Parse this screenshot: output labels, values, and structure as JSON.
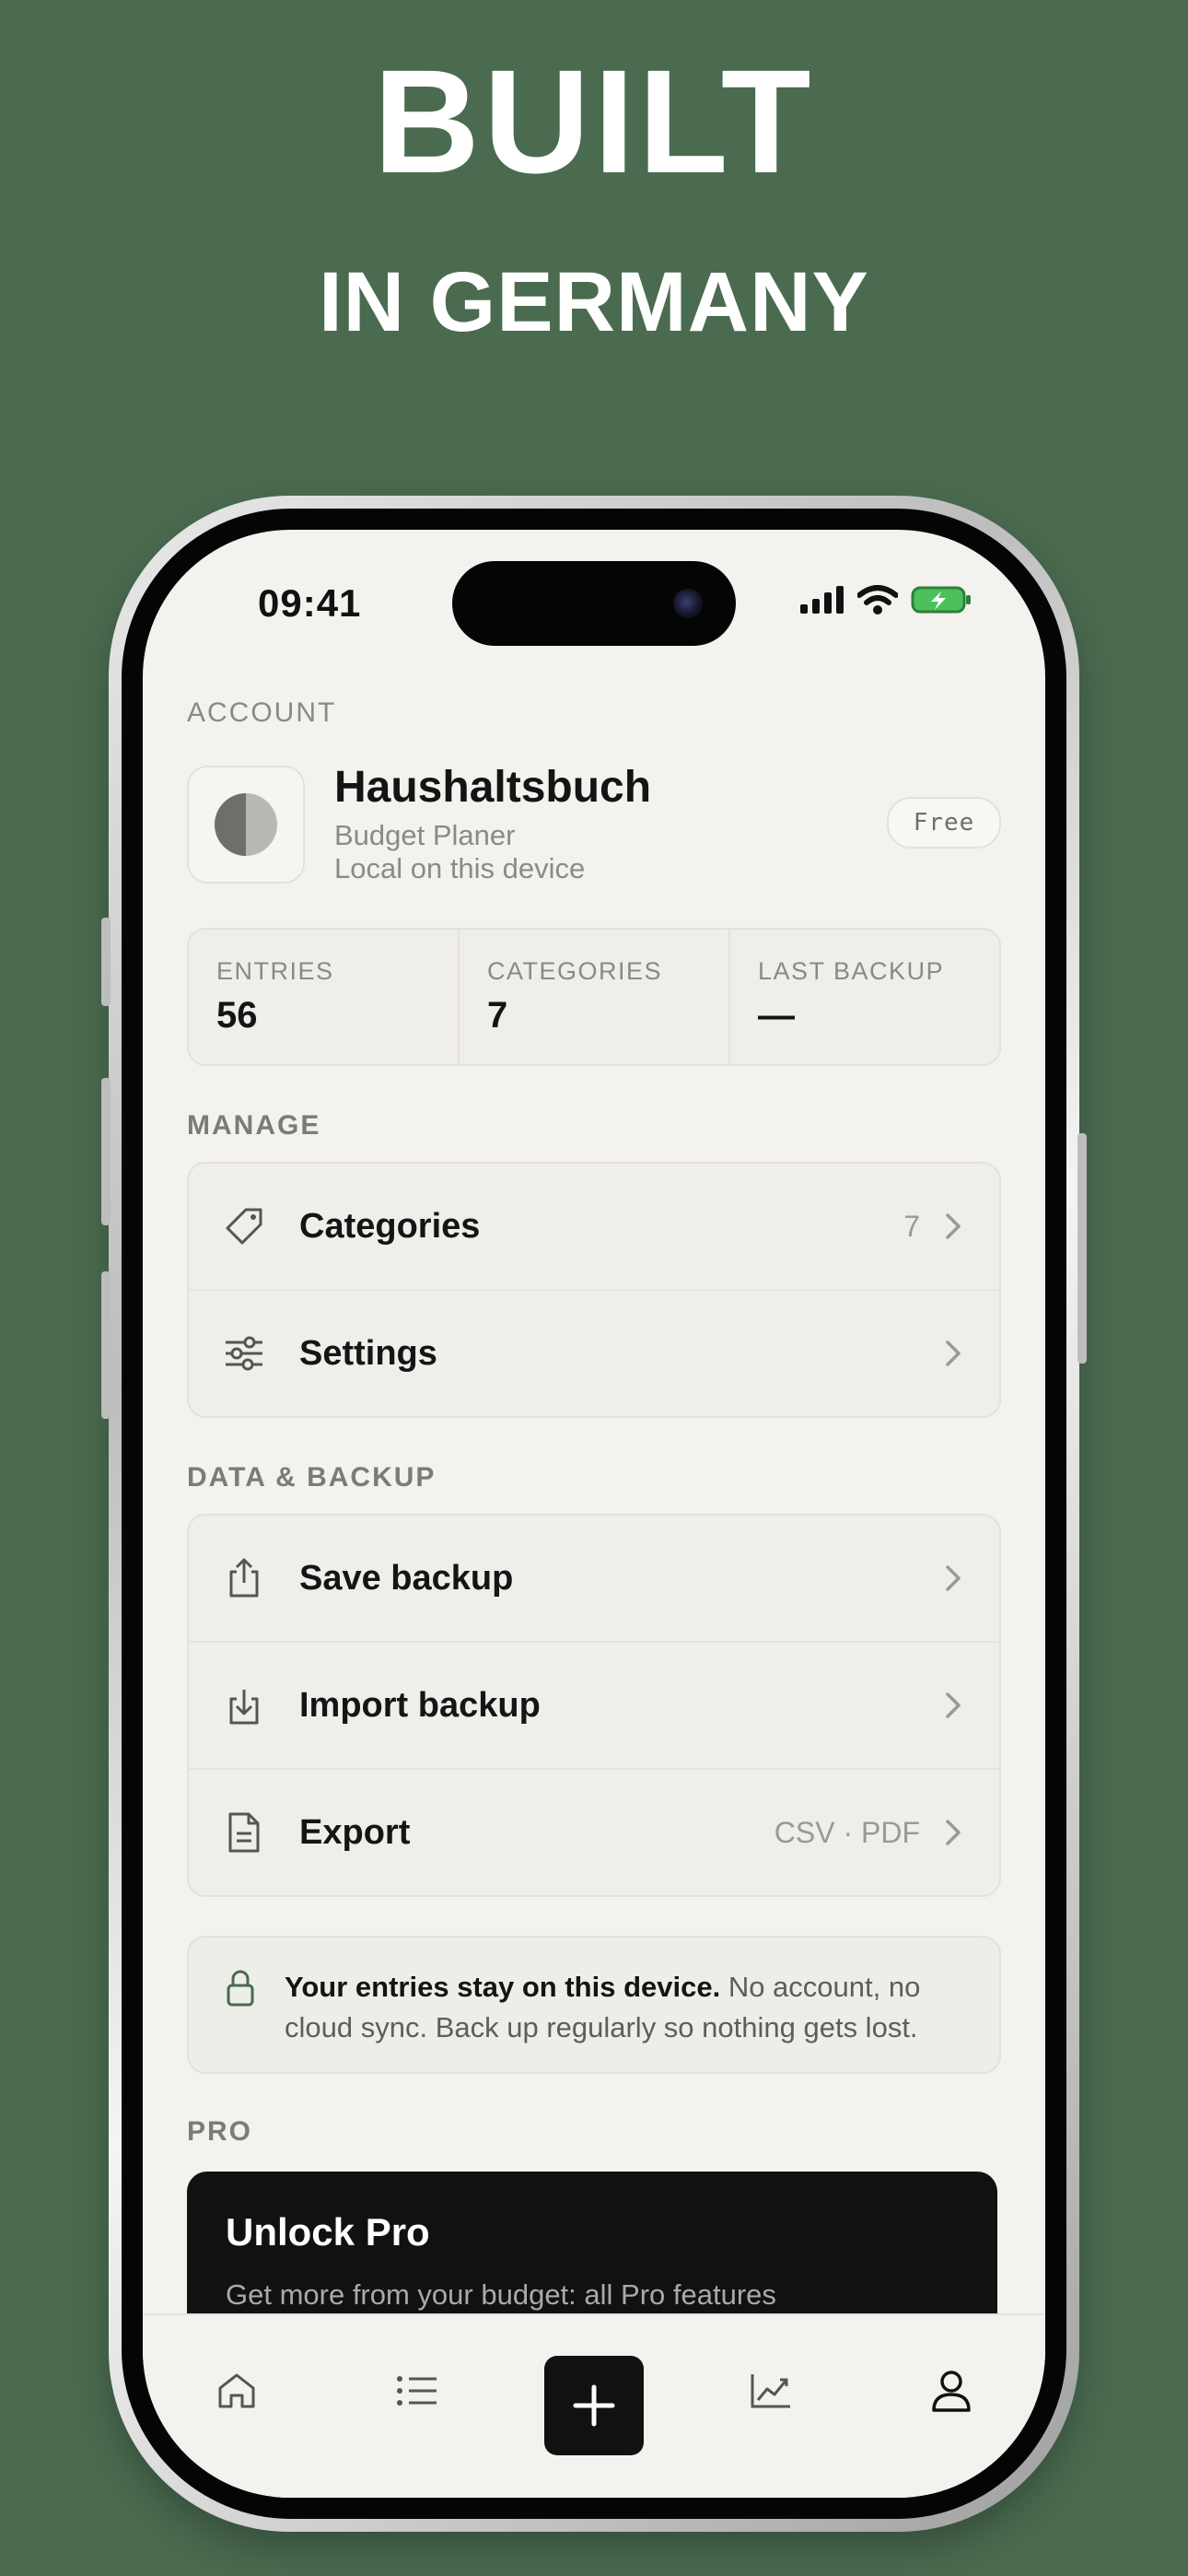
{
  "headline": {
    "line1": "BUILT",
    "line2": "IN GERMANY"
  },
  "status_bar": {
    "time": "09:41"
  },
  "account": {
    "section_label": "ACCOUNT",
    "name": "Haushaltsbuch",
    "subtitle": "Budget Planer",
    "storage": "Local on this device",
    "plan_badge": "Free"
  },
  "stats": [
    {
      "label": "ENTRIES",
      "value": "56"
    },
    {
      "label": "CATEGORIES",
      "value": "7"
    },
    {
      "label": "LAST BACKUP",
      "value": "—"
    }
  ],
  "manage": {
    "section_label": "MANAGE",
    "items": [
      {
        "label": "Categories",
        "value": "7",
        "icon": "tag-icon"
      },
      {
        "label": "Settings",
        "value": "",
        "icon": "sliders-icon"
      }
    ]
  },
  "backup": {
    "section_label": "DATA & BACKUP",
    "items": [
      {
        "label": "Save backup",
        "value": "",
        "icon": "share-icon"
      },
      {
        "label": "Import backup",
        "value": "",
        "icon": "import-icon"
      },
      {
        "label": "Export",
        "value": "CSV · PDF",
        "icon": "document-icon"
      }
    ]
  },
  "privacy": {
    "bold": "Your entries stay on this device.",
    "text": " No account, no cloud sync. Back up regularly so nothing gets lost."
  },
  "pro": {
    "section_label": "PRO",
    "title": "Unlock Pro",
    "subtitle": "Get more from your budget: all Pro features"
  },
  "tabbar": {
    "items": [
      "home-icon",
      "list-icon",
      "add-icon",
      "chart-icon",
      "profile-icon"
    ]
  },
  "colors": {
    "background": "#4a6b50",
    "screen": "#f3f2ee",
    "card": "#efeeea",
    "pro_card": "#111111"
  }
}
